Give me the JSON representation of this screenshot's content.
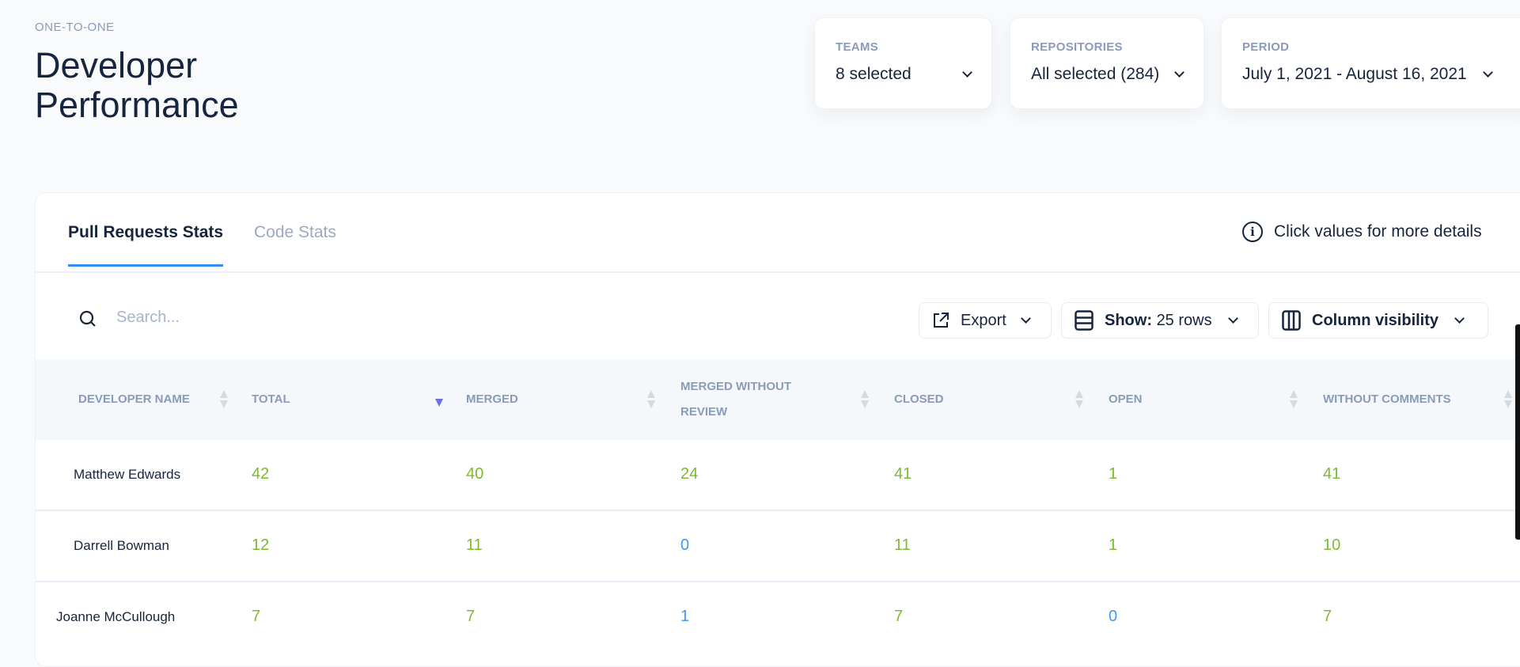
{
  "header": {
    "eyebrow": "ONE-TO-ONE",
    "title_line1": "Developer",
    "title_line2": "Performance"
  },
  "filters": [
    {
      "label": "TEAMS",
      "value": "8 selected"
    },
    {
      "label": "REPOSITORIES",
      "value": "All selected (284)"
    },
    {
      "label": "PERIOD",
      "value": "July 1, 2021 - August 16, 2021"
    }
  ],
  "tabs": [
    {
      "label": "Pull Requests Stats",
      "active": true
    },
    {
      "label": "Code Stats",
      "active": false
    }
  ],
  "info_text": "Click values for more details",
  "toolbar": {
    "search_placeholder": "Search...",
    "export_label": "Export",
    "show_label": "Show:",
    "show_value": "25 rows",
    "column_visibility_label": "Column visibility"
  },
  "columns": [
    "DEVELOPER NAME",
    "TOTAL",
    "MERGED",
    "MERGED WITHOUT REVIEW",
    "CLOSED",
    "OPEN",
    "WITHOUT COMMENTS"
  ],
  "sorted_column": "TOTAL",
  "sort_direction": "descending",
  "rows": [
    {
      "name": "Matthew Edwards",
      "values": [
        "42",
        "40",
        "24",
        "41",
        "1",
        "41"
      ]
    },
    {
      "name": "Darrell Bowman",
      "values": [
        "12",
        "11",
        "0",
        "11",
        "1",
        "10"
      ]
    },
    {
      "name": "Joanne McCullough",
      "values": [
        "7",
        "7",
        "1",
        "7",
        "0",
        "7"
      ]
    }
  ],
  "colors": {
    "positive": "#7cbb2f",
    "neutral": "#3a9bf0",
    "accent": "#2f8fef"
  }
}
